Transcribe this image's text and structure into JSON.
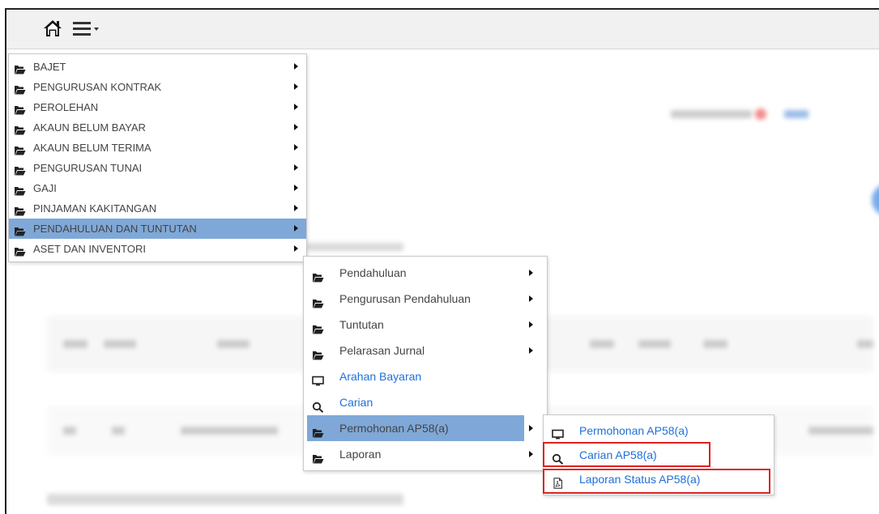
{
  "topbar": {
    "home_icon": "home-icon",
    "menu_icon": "hamburger-dropdown-icon"
  },
  "main_menu": {
    "items": [
      {
        "label": "BAJET",
        "icon": "folder-open-icon",
        "has_submenu": true
      },
      {
        "label": "PENGURUSAN KONTRAK",
        "icon": "folder-open-icon",
        "has_submenu": true
      },
      {
        "label": "PEROLEHAN",
        "icon": "folder-open-icon",
        "has_submenu": true
      },
      {
        "label": "AKAUN BELUM BAYAR",
        "icon": "folder-open-icon",
        "has_submenu": true
      },
      {
        "label": "AKAUN BELUM TERIMA",
        "icon": "folder-open-icon",
        "has_submenu": true
      },
      {
        "label": "PENGURUSAN TUNAI",
        "icon": "folder-open-icon",
        "has_submenu": true
      },
      {
        "label": "GAJI",
        "icon": "folder-open-icon",
        "has_submenu": true
      },
      {
        "label": "PINJAMAN KAKITANGAN",
        "icon": "folder-open-icon",
        "has_submenu": true
      },
      {
        "label": "PENDAHULUAN DAN TUNTUTAN",
        "icon": "folder-open-icon",
        "has_submenu": true,
        "active": true
      },
      {
        "label": "ASET DAN INVENTORI",
        "icon": "folder-open-icon",
        "has_submenu": true
      }
    ]
  },
  "submenu": {
    "items": [
      {
        "label": "Pendahuluan",
        "icon": "folder-open-icon",
        "has_submenu": true
      },
      {
        "label": "Pengurusan Pendahuluan",
        "icon": "folder-open-icon",
        "has_submenu": true
      },
      {
        "label": "Tuntutan",
        "icon": "folder-open-icon",
        "has_submenu": true
      },
      {
        "label": "Pelarasan Jurnal",
        "icon": "folder-open-icon",
        "has_submenu": true
      },
      {
        "label": "Arahan Bayaran",
        "icon": "monitor-icon",
        "has_submenu": false,
        "link": true
      },
      {
        "label": "Carian",
        "icon": "search-icon",
        "has_submenu": false,
        "link": true
      },
      {
        "label": "Permohonan AP58(a)",
        "icon": "folder-open-icon",
        "has_submenu": true,
        "active": true
      },
      {
        "label": "Laporan",
        "icon": "folder-open-icon",
        "has_submenu": true
      }
    ]
  },
  "subsubmenu": {
    "items": [
      {
        "label": "Permohonan AP58(a)",
        "icon": "monitor-icon",
        "link": true
      },
      {
        "label": "Carian AP58(a)",
        "icon": "search-icon",
        "link": true,
        "highlighted": true
      },
      {
        "label": "Laporan Status AP58(a)",
        "icon": "pdf-file-icon",
        "link": true,
        "highlighted": true
      }
    ]
  },
  "colors": {
    "active_item_bg": "#7fa8d8",
    "link": "#1e6fd9",
    "highlight_border": "#e02020",
    "topbar_bg": "#f1f1f1"
  }
}
